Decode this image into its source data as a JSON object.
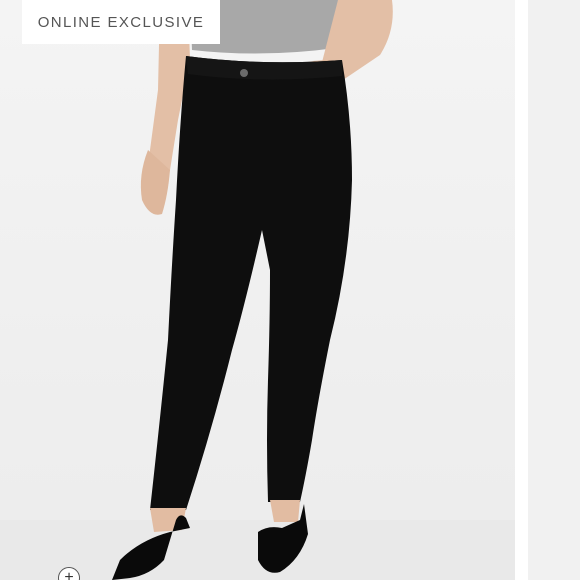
{
  "badge": {
    "label": "ONLINE EXCLUSIVE"
  },
  "image": {
    "icon": "jeans-model-photo"
  },
  "zoom": {
    "icon": "zoom-in-icon",
    "glyph": "+"
  },
  "colors": {
    "background": "#efefef",
    "jeans": "#0e0e0e",
    "top": "#a6a6a6",
    "skin": "#e6c3ab",
    "badge_text": "#555555"
  }
}
